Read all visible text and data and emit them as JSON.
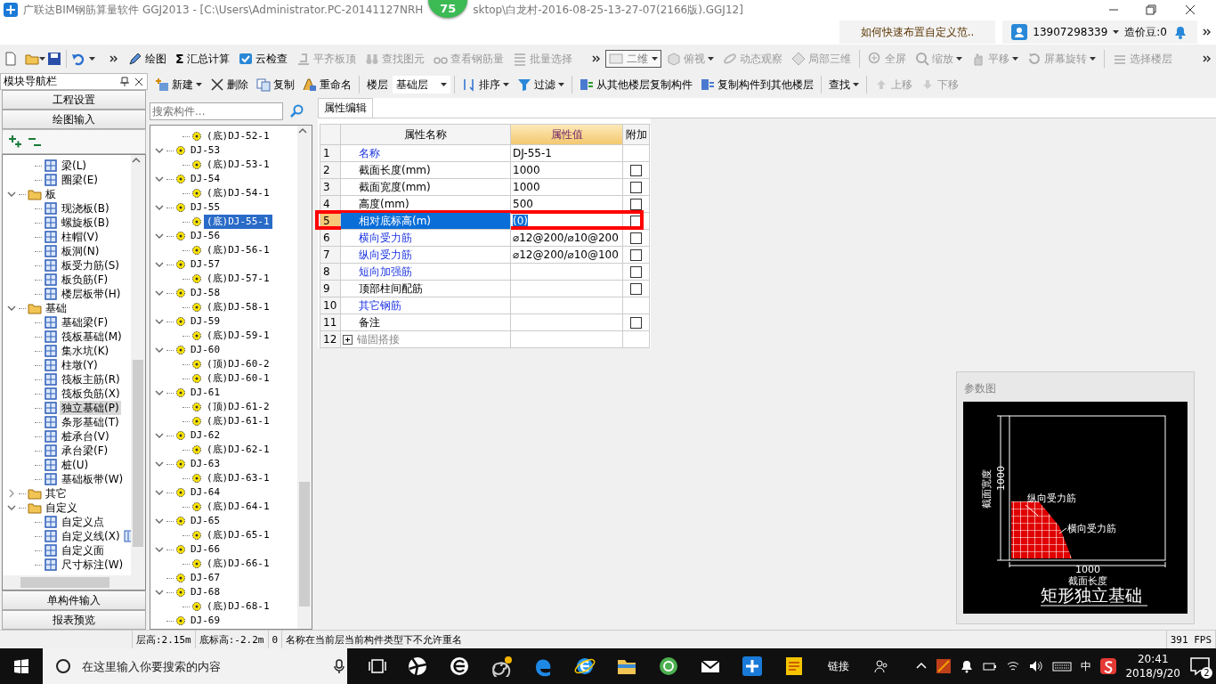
{
  "title_bar": {
    "title_start": "广联达BIM钢筋算量软件 GGJ2013 - [C:\\Users\\Administrator.PC-20141127NRH",
    "title_end": "sktop\\白龙村-2016-08-25-13-27-07(2166版).GGJ12]",
    "badge": "75"
  },
  "notice_bar": {
    "tip": "如何快速布置自定义范..",
    "phone": "13907298339",
    "beans": "造价豆:0"
  },
  "toolbar_main": [
    {
      "label": "绘图",
      "disabled": false,
      "dropdown": false
    },
    {
      "label": "汇总计算",
      "glyph": "Σ",
      "disabled": false,
      "dropdown": false
    },
    {
      "label": "云检查",
      "disabled": false,
      "dropdown": false
    },
    {
      "label": "平齐板顶",
      "disabled": true,
      "dropdown": false
    },
    {
      "label": "查找图元",
      "disabled": true,
      "dropdown": false
    },
    {
      "label": "查看钢筋量",
      "disabled": true,
      "dropdown": false
    },
    {
      "label": "批量选择",
      "disabled": true,
      "dropdown": false
    }
  ],
  "toolbar_view": {
    "mode": "二维",
    "items": [
      {
        "label": "俯视",
        "disabled": true,
        "dropdown": true
      },
      {
        "label": "动态观察",
        "disabled": true,
        "dropdown": false
      },
      {
        "label": "局部三维",
        "disabled": true,
        "dropdown": false
      },
      {
        "label": "全屏",
        "disabled": true,
        "dropdown": false
      },
      {
        "label": "缩放",
        "disabled": true,
        "dropdown": true
      },
      {
        "label": "平移",
        "disabled": true,
        "dropdown": true
      },
      {
        "label": "屏幕旋转",
        "disabled": true,
        "dropdown": true
      },
      {
        "label": "选择楼层",
        "disabled": true,
        "dropdown": false
      }
    ]
  },
  "toolbar_component": [
    {
      "kind": "button",
      "label": "新建",
      "disabled": false,
      "dropdown": true
    },
    {
      "kind": "button",
      "label": "删除",
      "disabled": false,
      "dropdown": false
    },
    {
      "kind": "button",
      "label": "复制",
      "disabled": false,
      "dropdown": false
    },
    {
      "kind": "button",
      "label": "重命名",
      "disabled": false,
      "dropdown": false
    },
    {
      "kind": "label",
      "label": "楼层"
    },
    {
      "kind": "select",
      "label": "基础层"
    },
    {
      "kind": "button",
      "label": "排序",
      "disabled": false,
      "dropdown": true
    },
    {
      "kind": "button",
      "label": "过滤",
      "disabled": false,
      "dropdown": true
    },
    {
      "kind": "button",
      "label": "从其他楼层复制构件",
      "disabled": false,
      "dropdown": false
    },
    {
      "kind": "button",
      "label": "复制构件到其他楼层",
      "disabled": false,
      "dropdown": false
    },
    {
      "kind": "button",
      "label": "查找",
      "disabled": false,
      "dropdown": true
    },
    {
      "kind": "button",
      "label": "上移",
      "disabled": true,
      "dropdown": false
    },
    {
      "kind": "button",
      "label": "下移",
      "disabled": true,
      "dropdown": false
    }
  ],
  "nav": {
    "title": "模块导航栏",
    "top_buttons": [
      "工程设置",
      "绘图输入"
    ],
    "bottom_buttons": [
      "单构件输入",
      "报表预览"
    ]
  },
  "nav_tree": [
    {
      "children": [
        {
          "label": "梁(L)",
          "selected": false
        },
        {
          "label": "圈梁(E)",
          "selected": false
        }
      ]
    },
    {
      "label": "板",
      "expanded": true,
      "selected": false,
      "children": [
        {
          "label": "现浇板(B)",
          "selected": false
        },
        {
          "label": "螺旋板(B)",
          "selected": false
        },
        {
          "label": "柱帽(V)",
          "selected": false
        },
        {
          "label": "板洞(N)",
          "selected": false
        },
        {
          "label": "板受力筋(S)",
          "selected": false
        },
        {
          "label": "板负筋(F)",
          "selected": false
        },
        {
          "label": "楼层板带(H)",
          "selected": false
        }
      ]
    },
    {
      "label": "基础",
      "expanded": true,
      "selected": false,
      "children": [
        {
          "label": "基础梁(F)",
          "selected": false
        },
        {
          "label": "筏板基础(M)",
          "selected": false
        },
        {
          "label": "集水坑(K)",
          "selected": false
        },
        {
          "label": "柱墩(Y)",
          "selected": false
        },
        {
          "label": "筏板主筋(R)",
          "selected": false
        },
        {
          "label": "筏板负筋(X)",
          "selected": false
        },
        {
          "label": "独立基础(P)",
          "selected": true
        },
        {
          "label": "条形基础(T)",
          "selected": false
        },
        {
          "label": "桩承台(V)",
          "selected": false
        },
        {
          "label": "承台梁(F)",
          "selected": false
        },
        {
          "label": "桩(U)",
          "selected": false
        },
        {
          "label": "基础板带(W)",
          "selected": false
        }
      ]
    },
    {
      "label": "其它",
      "expanded": false,
      "selected": false
    },
    {
      "label": "自定义",
      "expanded": true,
      "selected": false,
      "children": [
        {
          "label": "自定义点",
          "selected": false
        },
        {
          "label": "自定义线(X)",
          "selected": false,
          "extra_icon": true
        },
        {
          "label": "自定义面",
          "selected": false
        },
        {
          "label": "尺寸标注(W)",
          "selected": false
        }
      ]
    }
  ],
  "component_search": {
    "placeholder": "搜索构件..."
  },
  "component_tree": [
    {
      "children": [
        {
          "label": "(底)DJ-52-1",
          "selected": false
        }
      ]
    },
    {
      "label": "DJ-53",
      "expanded": true,
      "selected": false,
      "children": [
        {
          "label": "(底)DJ-53-1",
          "selected": false
        }
      ]
    },
    {
      "label": "DJ-54",
      "expanded": true,
      "selected": false,
      "children": [
        {
          "label": "(底)DJ-54-1",
          "selected": false
        }
      ]
    },
    {
      "label": "DJ-55",
      "expanded": true,
      "selected": false,
      "children": [
        {
          "label": "(底)DJ-55-1",
          "selected": true
        }
      ]
    },
    {
      "label": "DJ-56",
      "expanded": true,
      "selected": false,
      "children": [
        {
          "label": "(底)DJ-56-1",
          "selected": false
        }
      ]
    },
    {
      "label": "DJ-57",
      "expanded": true,
      "selected": false,
      "children": [
        {
          "label": "(底)DJ-57-1",
          "selected": false
        }
      ]
    },
    {
      "label": "DJ-58",
      "expanded": true,
      "selected": false,
      "children": [
        {
          "label": "(底)DJ-58-1",
          "selected": false
        }
      ]
    },
    {
      "label": "DJ-59",
      "expanded": true,
      "selected": false,
      "children": [
        {
          "label": "(底)DJ-59-1",
          "selected": false
        }
      ]
    },
    {
      "label": "DJ-60",
      "expanded": true,
      "selected": false,
      "children": [
        {
          "label": "(顶)DJ-60-2",
          "selected": false
        },
        {
          "label": "(底)DJ-60-1",
          "selected": false
        }
      ]
    },
    {
      "label": "DJ-61",
      "expanded": true,
      "selected": false,
      "children": [
        {
          "label": "(顶)DJ-61-2",
          "selected": false
        },
        {
          "label": "(底)DJ-61-1",
          "selected": false
        }
      ]
    },
    {
      "label": "DJ-62",
      "expanded": true,
      "selected": false,
      "children": [
        {
          "label": "(底)DJ-62-1",
          "selected": false
        }
      ]
    },
    {
      "label": "DJ-63",
      "expanded": true,
      "selected": false,
      "children": [
        {
          "label": "(底)DJ-63-1",
          "selected": false
        }
      ]
    },
    {
      "label": "DJ-64",
      "expanded": true,
      "selected": false,
      "children": [
        {
          "label": "(底)DJ-64-1",
          "selected": false
        }
      ]
    },
    {
      "label": "DJ-65",
      "expanded": true,
      "selected": false,
      "children": [
        {
          "label": "(底)DJ-65-1",
          "selected": false
        }
      ]
    },
    {
      "label": "DJ-66",
      "expanded": true,
      "selected": false,
      "children": [
        {
          "label": "(底)DJ-66-1",
          "selected": false
        }
      ]
    },
    {
      "label": "DJ-67",
      "selected": false
    },
    {
      "label": "DJ-68",
      "expanded": true,
      "selected": false,
      "children": [
        {
          "label": "(底)DJ-68-1",
          "selected": false
        }
      ]
    },
    {
      "label": "DJ-69",
      "selected": false
    }
  ],
  "property_panel": {
    "tab": "属性编辑",
    "columns": [
      {
        "label": "属性名称",
        "selected": false
      },
      {
        "label": "属性值",
        "selected": true
      },
      {
        "label": "附加",
        "selected": false
      }
    ],
    "rows": [
      {
        "kind": "property",
        "index": "1",
        "name": "名称",
        "value": "DJ-55-1",
        "link": true,
        "checkbox": false,
        "selected": false,
        "highlighted": false
      },
      {
        "kind": "property",
        "index": "2",
        "name": "截面长度(mm)",
        "value": "1000",
        "link": false,
        "checkbox": true,
        "checked": false,
        "selected": false,
        "highlighted": false
      },
      {
        "kind": "property",
        "index": "3",
        "name": "截面宽度(mm)",
        "value": "1000",
        "link": false,
        "checkbox": true,
        "checked": false,
        "selected": false,
        "highlighted": false
      },
      {
        "kind": "property",
        "index": "4",
        "name": "高度(mm)",
        "value": "500",
        "link": false,
        "checkbox": true,
        "checked": false,
        "selected": false,
        "highlighted": false
      },
      {
        "kind": "property",
        "index": "5",
        "name": "相对底标高(m)",
        "value": "(0)",
        "link": false,
        "checkbox": true,
        "checked": false,
        "selected": true,
        "highlighted": true
      },
      {
        "kind": "property",
        "index": "6",
        "name": "横向受力筋",
        "value": "⌀12@200/⌀10@200",
        "link": true,
        "checkbox": true,
        "checked": false,
        "selected": false,
        "highlighted": false
      },
      {
        "kind": "property",
        "index": "7",
        "name": "纵向受力筋",
        "value": "⌀12@200/⌀10@100",
        "link": true,
        "checkbox": true,
        "checked": false,
        "selected": false,
        "highlighted": false
      },
      {
        "kind": "property",
        "index": "8",
        "name": "短向加强筋",
        "value": "",
        "link": true,
        "checkbox": true,
        "checked": false,
        "selected": false,
        "highlighted": false
      },
      {
        "kind": "property",
        "index": "9",
        "name": "顶部柱间配筋",
        "value": "",
        "link": false,
        "checkbox": true,
        "checked": false,
        "selected": false,
        "highlighted": false
      },
      {
        "kind": "property",
        "index": "10",
        "name": "其它钢筋",
        "value": "",
        "link": true,
        "checkbox": false,
        "selected": false,
        "highlighted": false
      },
      {
        "kind": "property",
        "index": "11",
        "name": "备注",
        "value": "",
        "link": false,
        "checkbox": true,
        "checked": false,
        "selected": false,
        "highlighted": false
      },
      {
        "kind": "group",
        "index": "12",
        "name": "锚固搭接",
        "expanded": false,
        "selected": false,
        "highlighted": false
      }
    ]
  },
  "param_panel": {
    "title": "参数图",
    "width_label": "截面宽度",
    "width_value": "1000",
    "long_bar_label": "纵向受力筋",
    "cross_bar_label": "横向受力筋",
    "length_value": "1000",
    "length_label": "截面长度",
    "caption": "矩形独立基础"
  },
  "status_bar": [
    "层高:2.15m",
    "底标高:-2.2m",
    "0",
    "名称在当前层当前构件类型下不允许重名",
    "391 FPS"
  ],
  "taskbar": {
    "search_placeholder": "在这里输入你要搜索的内容",
    "links": "链接",
    "ime": "中",
    "time": "20:41",
    "date": "2018/9/20",
    "notifications": "2"
  }
}
